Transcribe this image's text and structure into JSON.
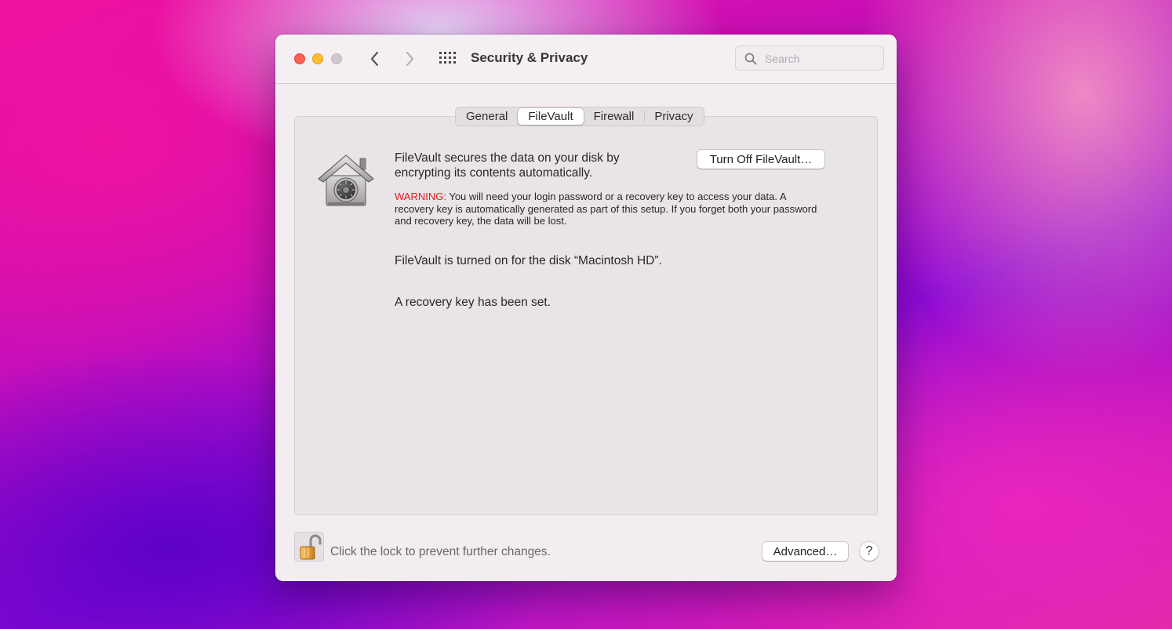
{
  "window": {
    "title": "Security & Privacy",
    "search_placeholder": "Search"
  },
  "tabs": [
    {
      "label": "General",
      "active": false
    },
    {
      "label": "FileVault",
      "active": true
    },
    {
      "label": "Firewall",
      "active": false
    },
    {
      "label": "Privacy",
      "active": false
    }
  ],
  "filevault": {
    "description": "FileVault secures the data on your disk by encrypting its contents automatically.",
    "warning_label": "WARNING:",
    "warning_text": " You will need your login password or a recovery key to access your data. A recovery key is automatically generated as part of this setup. If you forget both your password and recovery key, the data will be lost.",
    "turn_off_label": "Turn Off FileVault…",
    "status_disk": "FileVault is turned on for the disk “Macintosh HD”.",
    "status_recovery": "A recovery key has been set."
  },
  "footer": {
    "lock_text": "Click the lock to prevent further changes.",
    "advanced_label": "Advanced…",
    "help_label": "?"
  },
  "icons": {
    "close": "close-traffic-light",
    "minimize": "minimize-traffic-light",
    "zoom": "zoom-traffic-light",
    "back": "chevron-left-icon",
    "forward": "chevron-right-icon",
    "show_all": "grid-icon",
    "search": "search-icon",
    "filevault": "filevault-house-safe-icon",
    "lock": "unlocked-padlock-icon"
  },
  "colors": {
    "close": "#fe5f57",
    "minimize": "#febc2e",
    "zoom_disabled": "#cfc9ce",
    "warning": "#e8191e",
    "lock_gold": "#e8a23a"
  }
}
